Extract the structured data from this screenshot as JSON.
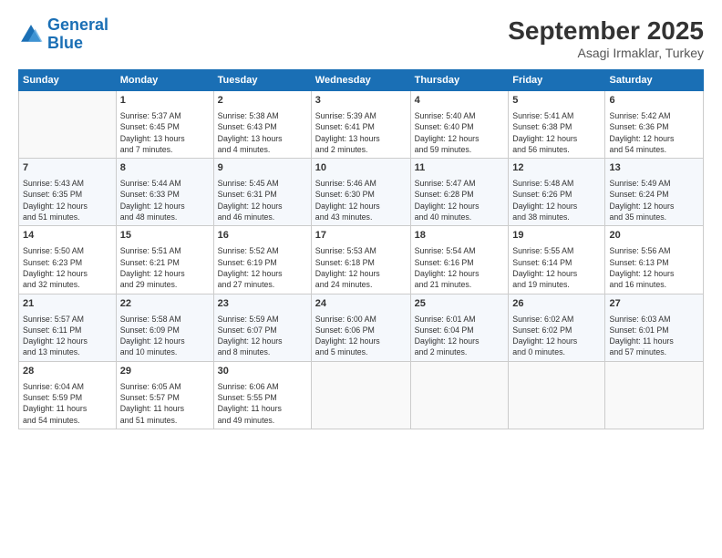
{
  "logo": {
    "line1": "General",
    "line2": "Blue"
  },
  "title": "September 2025",
  "subtitle": "Asagi Irmaklar, Turkey",
  "days_header": [
    "Sunday",
    "Monday",
    "Tuesday",
    "Wednesday",
    "Thursday",
    "Friday",
    "Saturday"
  ],
  "weeks": [
    [
      {
        "num": "",
        "info": ""
      },
      {
        "num": "1",
        "info": "Sunrise: 5:37 AM\nSunset: 6:45 PM\nDaylight: 13 hours\nand 7 minutes."
      },
      {
        "num": "2",
        "info": "Sunrise: 5:38 AM\nSunset: 6:43 PM\nDaylight: 13 hours\nand 4 minutes."
      },
      {
        "num": "3",
        "info": "Sunrise: 5:39 AM\nSunset: 6:41 PM\nDaylight: 13 hours\nand 2 minutes."
      },
      {
        "num": "4",
        "info": "Sunrise: 5:40 AM\nSunset: 6:40 PM\nDaylight: 12 hours\nand 59 minutes."
      },
      {
        "num": "5",
        "info": "Sunrise: 5:41 AM\nSunset: 6:38 PM\nDaylight: 12 hours\nand 56 minutes."
      },
      {
        "num": "6",
        "info": "Sunrise: 5:42 AM\nSunset: 6:36 PM\nDaylight: 12 hours\nand 54 minutes."
      }
    ],
    [
      {
        "num": "7",
        "info": "Sunrise: 5:43 AM\nSunset: 6:35 PM\nDaylight: 12 hours\nand 51 minutes."
      },
      {
        "num": "8",
        "info": "Sunrise: 5:44 AM\nSunset: 6:33 PM\nDaylight: 12 hours\nand 48 minutes."
      },
      {
        "num": "9",
        "info": "Sunrise: 5:45 AM\nSunset: 6:31 PM\nDaylight: 12 hours\nand 46 minutes."
      },
      {
        "num": "10",
        "info": "Sunrise: 5:46 AM\nSunset: 6:30 PM\nDaylight: 12 hours\nand 43 minutes."
      },
      {
        "num": "11",
        "info": "Sunrise: 5:47 AM\nSunset: 6:28 PM\nDaylight: 12 hours\nand 40 minutes."
      },
      {
        "num": "12",
        "info": "Sunrise: 5:48 AM\nSunset: 6:26 PM\nDaylight: 12 hours\nand 38 minutes."
      },
      {
        "num": "13",
        "info": "Sunrise: 5:49 AM\nSunset: 6:24 PM\nDaylight: 12 hours\nand 35 minutes."
      }
    ],
    [
      {
        "num": "14",
        "info": "Sunrise: 5:50 AM\nSunset: 6:23 PM\nDaylight: 12 hours\nand 32 minutes."
      },
      {
        "num": "15",
        "info": "Sunrise: 5:51 AM\nSunset: 6:21 PM\nDaylight: 12 hours\nand 29 minutes."
      },
      {
        "num": "16",
        "info": "Sunrise: 5:52 AM\nSunset: 6:19 PM\nDaylight: 12 hours\nand 27 minutes."
      },
      {
        "num": "17",
        "info": "Sunrise: 5:53 AM\nSunset: 6:18 PM\nDaylight: 12 hours\nand 24 minutes."
      },
      {
        "num": "18",
        "info": "Sunrise: 5:54 AM\nSunset: 6:16 PM\nDaylight: 12 hours\nand 21 minutes."
      },
      {
        "num": "19",
        "info": "Sunrise: 5:55 AM\nSunset: 6:14 PM\nDaylight: 12 hours\nand 19 minutes."
      },
      {
        "num": "20",
        "info": "Sunrise: 5:56 AM\nSunset: 6:13 PM\nDaylight: 12 hours\nand 16 minutes."
      }
    ],
    [
      {
        "num": "21",
        "info": "Sunrise: 5:57 AM\nSunset: 6:11 PM\nDaylight: 12 hours\nand 13 minutes."
      },
      {
        "num": "22",
        "info": "Sunrise: 5:58 AM\nSunset: 6:09 PM\nDaylight: 12 hours\nand 10 minutes."
      },
      {
        "num": "23",
        "info": "Sunrise: 5:59 AM\nSunset: 6:07 PM\nDaylight: 12 hours\nand 8 minutes."
      },
      {
        "num": "24",
        "info": "Sunrise: 6:00 AM\nSunset: 6:06 PM\nDaylight: 12 hours\nand 5 minutes."
      },
      {
        "num": "25",
        "info": "Sunrise: 6:01 AM\nSunset: 6:04 PM\nDaylight: 12 hours\nand 2 minutes."
      },
      {
        "num": "26",
        "info": "Sunrise: 6:02 AM\nSunset: 6:02 PM\nDaylight: 12 hours\nand 0 minutes."
      },
      {
        "num": "27",
        "info": "Sunrise: 6:03 AM\nSunset: 6:01 PM\nDaylight: 11 hours\nand 57 minutes."
      }
    ],
    [
      {
        "num": "28",
        "info": "Sunrise: 6:04 AM\nSunset: 5:59 PM\nDaylight: 11 hours\nand 54 minutes."
      },
      {
        "num": "29",
        "info": "Sunrise: 6:05 AM\nSunset: 5:57 PM\nDaylight: 11 hours\nand 51 minutes."
      },
      {
        "num": "30",
        "info": "Sunrise: 6:06 AM\nSunset: 5:55 PM\nDaylight: 11 hours\nand 49 minutes."
      },
      {
        "num": "",
        "info": ""
      },
      {
        "num": "",
        "info": ""
      },
      {
        "num": "",
        "info": ""
      },
      {
        "num": "",
        "info": ""
      }
    ]
  ]
}
